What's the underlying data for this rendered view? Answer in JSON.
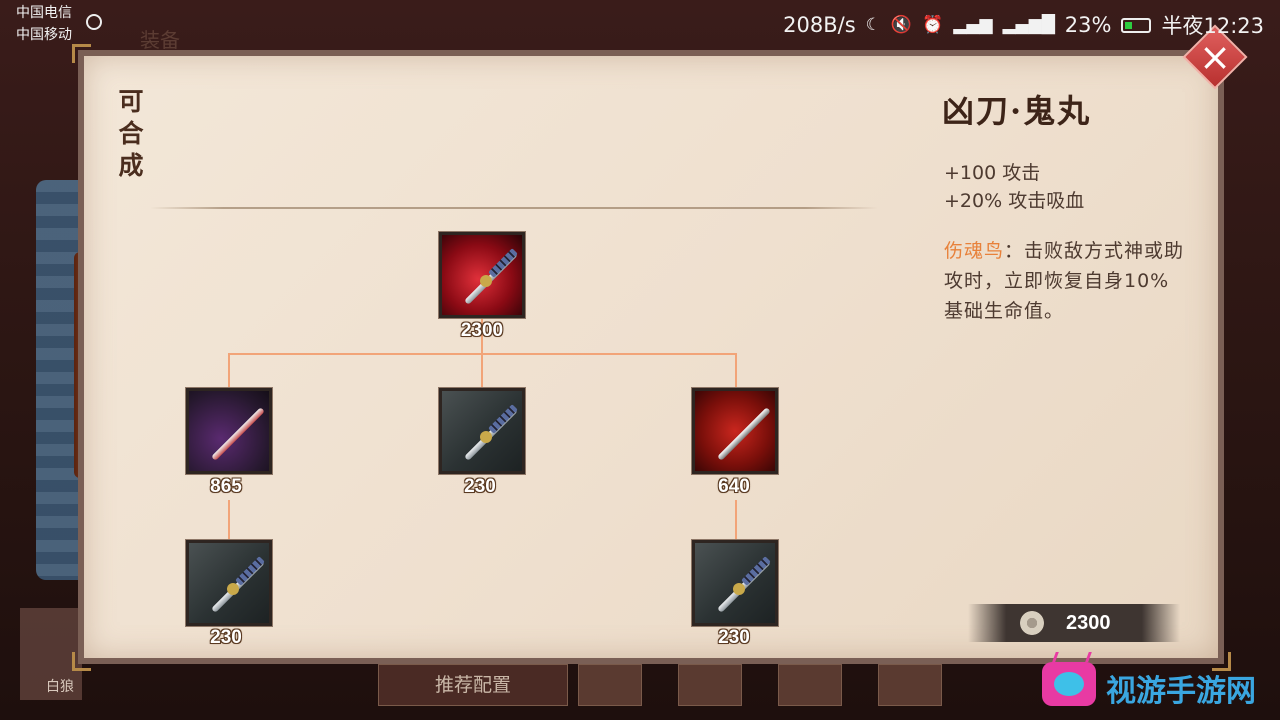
{
  "status_bar": {
    "carrier1": "中国电信",
    "carrier2": "中国移动",
    "speed": "208B/s",
    "battery": "23%",
    "time": "半夜12:23"
  },
  "background": {
    "top_tab": "装备",
    "hero_label": "白狼",
    "recommend_button": "推荐配置"
  },
  "panel": {
    "synthesizable_label": "可合成",
    "close_label": "×"
  },
  "tree": {
    "root": {
      "price": "2300"
    },
    "children": [
      {
        "price": "865",
        "kind": "bone-sword"
      },
      {
        "price": "230",
        "kind": "katana"
      },
      {
        "price": "640",
        "kind": "claw-blade"
      }
    ],
    "grandchildren": [
      {
        "price": "230",
        "kind": "katana"
      },
      {
        "price": "230",
        "kind": "katana"
      }
    ]
  },
  "details": {
    "name": "凶刀·鬼丸",
    "stat1": "+100 攻击",
    "stat2": "+20% 攻击吸血",
    "skill_name": "伤魂鸟",
    "skill_desc": "：击败敌方式神或助攻时，立即恢复自身10%基础生命值。",
    "total_price": "2300"
  },
  "watermark": {
    "text": "视游手游网"
  },
  "colors": {
    "connector": "#f2a478",
    "skill_name": "#e8813a",
    "panel_bg": "#f3e7d8",
    "close_button": "#d04846"
  }
}
